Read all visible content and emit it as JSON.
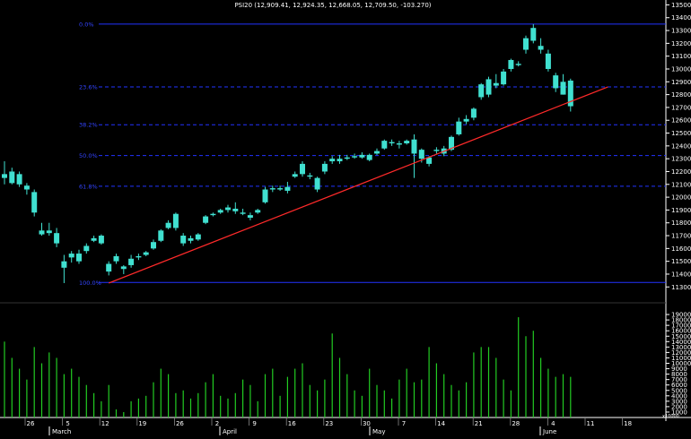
{
  "title": "PSI20 (12,909.41, 12,924.35, 12,668.05, 12,709.50, -103.270)",
  "colors": {
    "background": "#000000",
    "candle": "#40e0d0",
    "volume": "#22cc22",
    "fib_line": "#2233ff",
    "fib_label": "#3344ff",
    "trend_line": "#ff2a2a",
    "axis_text": "#ffffff",
    "frame": "#ffffff"
  },
  "chart_data": {
    "type": "candlestick",
    "title": "PSI20 (12,909.41, 12,924.35, 12,668.05, 12,709.50, -103.270)",
    "y_ticks": [
      11300,
      11400,
      11500,
      11600,
      11700,
      11800,
      11900,
      12000,
      12100,
      12200,
      12300,
      12400,
      12500,
      12600,
      12700,
      12800,
      12900,
      13000,
      13100,
      13200,
      13300,
      13400,
      13500
    ],
    "ylim": [
      11260,
      13510
    ],
    "volume_ticks": [
      1000,
      2000,
      3000,
      4000,
      5000,
      6000,
      7000,
      8000,
      9000,
      10000,
      11000,
      12000,
      13000,
      14000,
      15000,
      16000,
      17000,
      18000,
      19000
    ],
    "volume_unit_label": "x10000",
    "volume_ylim": [
      0,
      20000
    ],
    "x_day_labels": [
      "26",
      "5",
      "12",
      "19",
      "26",
      "2",
      "9",
      "16",
      "23",
      "30",
      "7",
      "14",
      "21",
      "28",
      "4",
      "11",
      "18"
    ],
    "month_labels": [
      "March",
      "April",
      "May",
      "June"
    ],
    "fibonacci": [
      {
        "label": "0.0%",
        "value": 13350
      },
      {
        "label": "23.6%",
        "value": 12860
      },
      {
        "label": "38.2%",
        "value": 12565
      },
      {
        "label": "50.0%",
        "value": 12325
      },
      {
        "label": "61.8%",
        "value": 12085
      },
      {
        "label": "100.0%",
        "value": 11335
      }
    ],
    "trendline": {
      "start_index": 14,
      "start_value": 11330,
      "end_index": 81,
      "end_value": 12860
    },
    "candles": [
      {
        "o": 12150,
        "h": 12280,
        "l": 12100,
        "c": 12180,
        "v": 14000
      },
      {
        "o": 12200,
        "h": 12230,
        "l": 12100,
        "c": 12110,
        "v": 11000
      },
      {
        "o": 12180,
        "h": 12200,
        "l": 12080,
        "c": 12100,
        "v": 9000
      },
      {
        "o": 12090,
        "h": 12110,
        "l": 12020,
        "c": 12060,
        "v": 7000
      },
      {
        "o": 12040,
        "h": 12060,
        "l": 11850,
        "c": 11880,
        "v": 13000
      },
      {
        "o": 11740,
        "h": 11800,
        "l": 11700,
        "c": 11710,
        "v": 10000
      },
      {
        "o": 11740,
        "h": 11800,
        "l": 11700,
        "c": 11720,
        "v": 12000
      },
      {
        "o": 11720,
        "h": 11760,
        "l": 11610,
        "c": 11640,
        "v": 11000
      },
      {
        "o": 11500,
        "h": 11550,
        "l": 11330,
        "c": 11450,
        "v": 8000
      },
      {
        "o": 11530,
        "h": 11580,
        "l": 11490,
        "c": 11560,
        "v": 9000
      },
      {
        "o": 11500,
        "h": 11590,
        "l": 11480,
        "c": 11560,
        "v": 7500
      },
      {
        "o": 11580,
        "h": 11640,
        "l": 11560,
        "c": 11620,
        "v": 6000
      },
      {
        "o": 11660,
        "h": 11700,
        "l": 11650,
        "c": 11680,
        "v": 4500
      },
      {
        "o": 11700,
        "h": 11710,
        "l": 11630,
        "c": 11640,
        "v": 3000
      },
      {
        "o": 11420,
        "h": 11500,
        "l": 11390,
        "c": 11480,
        "v": 6000
      },
      {
        "o": 11500,
        "h": 11560,
        "l": 11480,
        "c": 11540,
        "v": 1500
      },
      {
        "o": 11440,
        "h": 11470,
        "l": 11400,
        "c": 11460,
        "v": 1000
      },
      {
        "o": 11470,
        "h": 11550,
        "l": 11450,
        "c": 11520,
        "v": 3000
      },
      {
        "o": 11530,
        "h": 11560,
        "l": 11510,
        "c": 11540,
        "v": 3500
      },
      {
        "o": 11550,
        "h": 11580,
        "l": 11540,
        "c": 11570,
        "v": 4000
      },
      {
        "o": 11600,
        "h": 11670,
        "l": 11590,
        "c": 11650,
        "v": 6500
      },
      {
        "o": 11660,
        "h": 11750,
        "l": 11650,
        "c": 11740,
        "v": 9000
      },
      {
        "o": 11760,
        "h": 11820,
        "l": 11750,
        "c": 11800,
        "v": 8000
      },
      {
        "o": 11760,
        "h": 11880,
        "l": 11740,
        "c": 11870,
        "v": 4500
      },
      {
        "o": 11640,
        "h": 11720,
        "l": 11620,
        "c": 11700,
        "v": 5000
      },
      {
        "o": 11660,
        "h": 11700,
        "l": 11640,
        "c": 11680,
        "v": 3500
      },
      {
        "o": 11670,
        "h": 11720,
        "l": 11660,
        "c": 11710,
        "v": 4500
      },
      {
        "o": 11800,
        "h": 11860,
        "l": 11790,
        "c": 11850,
        "v": 6500
      },
      {
        "o": 11860,
        "h": 11880,
        "l": 11850,
        "c": 11870,
        "v": 8000
      },
      {
        "o": 11880,
        "h": 11910,
        "l": 11870,
        "c": 11900,
        "v": 4000
      },
      {
        "o": 11900,
        "h": 11940,
        "l": 11880,
        "c": 11920,
        "v": 3500
      },
      {
        "o": 11910,
        "h": 11960,
        "l": 11870,
        "c": 11890,
        "v": 4500
      },
      {
        "o": 11880,
        "h": 11910,
        "l": 11860,
        "c": 11870,
        "v": 7000
      },
      {
        "o": 11840,
        "h": 11880,
        "l": 11820,
        "c": 11860,
        "v": 6000
      },
      {
        "o": 11880,
        "h": 11910,
        "l": 11870,
        "c": 11900,
        "v": 3000
      },
      {
        "o": 11960,
        "h": 12080,
        "l": 11950,
        "c": 12060,
        "v": 8000
      },
      {
        "o": 12060,
        "h": 12090,
        "l": 12040,
        "c": 12070,
        "v": 9000
      },
      {
        "o": 12060,
        "h": 12090,
        "l": 12050,
        "c": 12070,
        "v": 4000
      },
      {
        "o": 12080,
        "h": 12120,
        "l": 12030,
        "c": 12050,
        "v": 7500
      },
      {
        "o": 12160,
        "h": 12200,
        "l": 12150,
        "c": 12180,
        "v": 9000
      },
      {
        "o": 12180,
        "h": 12280,
        "l": 12160,
        "c": 12260,
        "v": 10000
      },
      {
        "o": 12160,
        "h": 12190,
        "l": 12140,
        "c": 12170,
        "v": 6000
      },
      {
        "o": 12060,
        "h": 12160,
        "l": 12040,
        "c": 12150,
        "v": 5000
      },
      {
        "o": 12200,
        "h": 12280,
        "l": 12180,
        "c": 12260,
        "v": 7000
      },
      {
        "o": 12280,
        "h": 12320,
        "l": 12260,
        "c": 12300,
        "v": 15500
      },
      {
        "o": 12280,
        "h": 12330,
        "l": 12260,
        "c": 12300,
        "v": 11000
      },
      {
        "o": 12300,
        "h": 12330,
        "l": 12290,
        "c": 12310,
        "v": 8000
      },
      {
        "o": 12320,
        "h": 12340,
        "l": 12300,
        "c": 12310,
        "v": 5000
      },
      {
        "o": 12330,
        "h": 12350,
        "l": 12300,
        "c": 12310,
        "v": 4000
      },
      {
        "o": 12290,
        "h": 12340,
        "l": 12280,
        "c": 12330,
        "v": 9000
      },
      {
        "o": 12340,
        "h": 12380,
        "l": 12330,
        "c": 12360,
        "v": 6000
      },
      {
        "o": 12380,
        "h": 12450,
        "l": 12370,
        "c": 12440,
        "v": 5000
      },
      {
        "o": 12420,
        "h": 12450,
        "l": 12400,
        "c": 12430,
        "v": 3500
      },
      {
        "o": 12410,
        "h": 12440,
        "l": 12380,
        "c": 12420,
        "v": 7000
      },
      {
        "o": 12420,
        "h": 12450,
        "l": 12410,
        "c": 12440,
        "v": 9000
      },
      {
        "o": 12340,
        "h": 12490,
        "l": 12150,
        "c": 12450,
        "v": 6500
      },
      {
        "o": 12300,
        "h": 12380,
        "l": 12270,
        "c": 12370,
        "v": 7000
      },
      {
        "o": 12260,
        "h": 12320,
        "l": 12240,
        "c": 12310,
        "v": 13000
      },
      {
        "o": 12360,
        "h": 12390,
        "l": 12340,
        "c": 12370,
        "v": 10000
      },
      {
        "o": 12340,
        "h": 12400,
        "l": 12320,
        "c": 12380,
        "v": 8000
      },
      {
        "o": 12370,
        "h": 12480,
        "l": 12360,
        "c": 12470,
        "v": 6000
      },
      {
        "o": 12490,
        "h": 12620,
        "l": 12480,
        "c": 12590,
        "v": 5000
      },
      {
        "o": 12590,
        "h": 12640,
        "l": 12570,
        "c": 12610,
        "v": 6500
      },
      {
        "o": 12620,
        "h": 12700,
        "l": 12600,
        "c": 12690,
        "v": 12000
      },
      {
        "o": 12780,
        "h": 12890,
        "l": 12760,
        "c": 12880,
        "v": 13000
      },
      {
        "o": 12800,
        "h": 12940,
        "l": 12780,
        "c": 12920,
        "v": 13000
      },
      {
        "o": 12870,
        "h": 12960,
        "l": 12850,
        "c": 12890,
        "v": 11000
      },
      {
        "o": 12880,
        "h": 13000,
        "l": 12870,
        "c": 12980,
        "v": 7000
      },
      {
        "o": 13000,
        "h": 13080,
        "l": 12980,
        "c": 13070,
        "v": 5000
      },
      {
        "o": 13030,
        "h": 13060,
        "l": 13020,
        "c": 13040,
        "v": 18500
      },
      {
        "o": 13150,
        "h": 13260,
        "l": 13120,
        "c": 13240,
        "v": 15000
      },
      {
        "o": 13220,
        "h": 13350,
        "l": 13200,
        "c": 13320,
        "v": 16000
      },
      {
        "o": 13180,
        "h": 13240,
        "l": 13120,
        "c": 13150,
        "v": 11000
      },
      {
        "o": 13120,
        "h": 13150,
        "l": 12980,
        "c": 13000,
        "v": 9000
      },
      {
        "o": 12950,
        "h": 12970,
        "l": 12820,
        "c": 12850,
        "v": 7500
      },
      {
        "o": 12900,
        "h": 12960,
        "l": 12800,
        "c": 12800,
        "v": 8000
      },
      {
        "o": 12909.41,
        "h": 12924.35,
        "l": 12668.05,
        "c": 12709.5,
        "v": 7500
      }
    ]
  }
}
